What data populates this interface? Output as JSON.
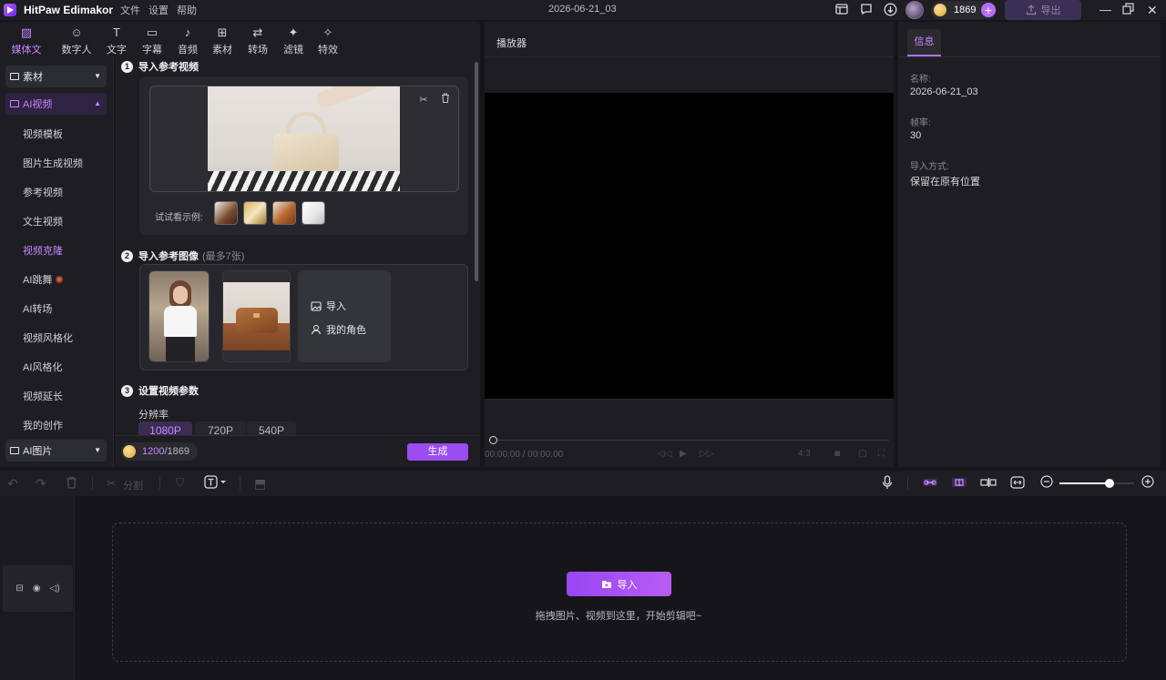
{
  "app": {
    "name": "HitPaw Edimakor",
    "menus": [
      "文件",
      "设置",
      "帮助"
    ],
    "doc_title": "2026-06-21_03",
    "credits": "1869",
    "export_label": "导出"
  },
  "toolbar": {
    "items": [
      {
        "label": "媒体文件",
        "icon": "media-icon"
      },
      {
        "label": "数字人",
        "icon": "avatar-person-icon"
      },
      {
        "label": "文字",
        "icon": "text-icon"
      },
      {
        "label": "字幕",
        "icon": "subtitle-icon"
      },
      {
        "label": "音频",
        "icon": "audio-note-icon"
      },
      {
        "label": "素材",
        "icon": "assets-grid-icon"
      },
      {
        "label": "转场",
        "icon": "transition-arrows-icon"
      },
      {
        "label": "滤镜",
        "icon": "filter-sparkle-icon"
      },
      {
        "label": "特效",
        "icon": "effects-icon"
      }
    ]
  },
  "sidebar": {
    "group_assets": "素材",
    "group_ai_video": "AI视频",
    "items": [
      "视频模板",
      "图片生成视频",
      "参考视频",
      "文生视频",
      "视频克隆",
      "AI跳舞",
      "AI转场",
      "视频风格化",
      "AI风格化",
      "视频延长",
      "我的创作"
    ],
    "selected": "视频克隆",
    "group_ai_image": "AI图片"
  },
  "content": {
    "step1": {
      "num": "1",
      "title": "导入参考视频"
    },
    "samples_label": "试试看示例:",
    "step2": {
      "num": "2",
      "title": "导入参考图像",
      "hint": "(最多7张)"
    },
    "import_label": "导入",
    "my_roles_label": "我的角色",
    "step3": {
      "num": "3",
      "title": "设置视频参数"
    },
    "resolution_label": "分辨率",
    "resolutions": [
      "1080P",
      "720P",
      "540P"
    ],
    "selected_resolution": "1080P",
    "cost": "1200",
    "balance": "/1869",
    "generate_label": "生成"
  },
  "player": {
    "title": "播放器",
    "timecode": "00:00:00",
    "duration": "/ 00:00:00",
    "ratio": "4:3"
  },
  "info": {
    "tab": "信息",
    "fields": [
      {
        "label": "名称:",
        "value": "2026-06-21_03"
      },
      {
        "label": "帧率:",
        "value": "30"
      },
      {
        "label": "导入方式:",
        "value": "保留在原有位置"
      }
    ]
  },
  "edit_toolbar": {
    "split_label": "分割"
  },
  "timeline": {
    "import_label": "导入",
    "drop_hint": "拖拽图片、视频到这里，开始剪辑吧~"
  },
  "colors": {
    "accent": "#b86cf7",
    "generate": "#9b4cf0",
    "panel": "#1d1d22",
    "background": "#16161a"
  }
}
